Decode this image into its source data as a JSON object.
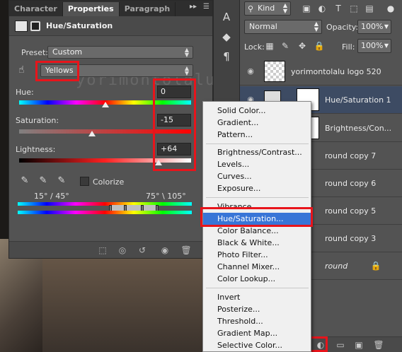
{
  "tabs": [
    "Character",
    "Properties",
    "Paragraph"
  ],
  "properties": {
    "title": "Hue/Saturation",
    "preset_label": "Preset:",
    "preset_value": "Custom",
    "channel_value": "Yellows",
    "hue_label": "Hue:",
    "hue_value": "0",
    "saturation_label": "Saturation:",
    "saturation_value": "-15",
    "lightness_label": "Lightness:",
    "lightness_value": "+64",
    "colorize_label": "Colorize",
    "range_left": "15° / 45°",
    "range_right": "75° \\ 105°",
    "watermark": "yorimontolalu.com"
  },
  "layers_panel": {
    "kind_label": "Kind",
    "blend_mode": "Normal",
    "opacity_label": "Opacity:",
    "opacity_value": "100%",
    "lock_label": "Lock:",
    "fill_label": "Fill:",
    "fill_value": "100%",
    "layers": [
      {
        "name": "yorimontolalu logo 520"
      },
      {
        "name": "Hue/Saturation 1"
      },
      {
        "name": "Brightness/Con..."
      },
      {
        "name": "round copy 7"
      },
      {
        "name": "round copy 6"
      },
      {
        "name": "round copy 5"
      },
      {
        "name": "round copy 3"
      },
      {
        "name": "round"
      }
    ]
  },
  "menu": {
    "items": [
      "Solid Color...",
      "Gradient...",
      "Pattern...",
      "Brightness/Contrast...",
      "Levels...",
      "Curves...",
      "Exposure...",
      "Vibrance...",
      "Hue/Saturation...",
      "Color Balance...",
      "Black & White...",
      "Photo Filter...",
      "Channel Mixer...",
      "Color Lookup...",
      "Invert",
      "Posterize...",
      "Threshold...",
      "Gradient Map...",
      "Selective Color..."
    ]
  },
  "colors": {
    "highlight": "#e8141b",
    "menu_selection": "#3875d7",
    "layer_selection": "#3d4b63"
  }
}
